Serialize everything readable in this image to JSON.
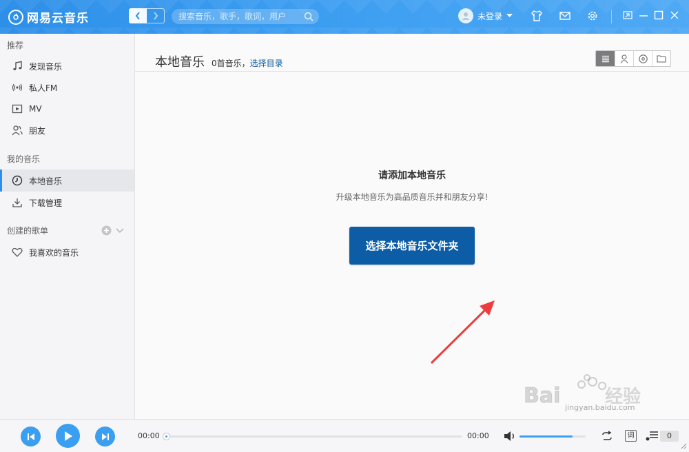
{
  "app": {
    "name": "网易云音乐"
  },
  "search": {
    "placeholder": "搜索音乐，歌手，歌词，用户"
  },
  "user": {
    "status": "未登录"
  },
  "sidebar": {
    "groups": [
      {
        "label": "推荐"
      },
      {
        "label": "我的音乐"
      },
      {
        "label": "创建的歌单"
      }
    ],
    "items": [
      {
        "label": "发现音乐",
        "icon": "music-note-icon"
      },
      {
        "label": "私人FM",
        "icon": "radio-icon"
      },
      {
        "label": "MV",
        "icon": "video-icon"
      },
      {
        "label": "朋友",
        "icon": "friends-icon"
      },
      {
        "label": "本地音乐",
        "icon": "local-music-icon",
        "active": true
      },
      {
        "label": "下载管理",
        "icon": "download-icon"
      },
      {
        "label": "我喜欢的音乐",
        "icon": "heart-icon"
      }
    ]
  },
  "main": {
    "title": "本地音乐",
    "count_text": "0首音乐，",
    "select_dir_link": "选择目录",
    "empty_title": "请添加本地音乐",
    "empty_subtitle": "升级本地音乐为高品质音乐并和朋友分享!",
    "choose_button": "选择本地音乐文件夹",
    "view_modes": [
      "list-view-icon",
      "artist-view-icon",
      "album-view-icon",
      "folder-view-icon"
    ]
  },
  "player": {
    "current_time": "00:00",
    "total_time": "00:00",
    "progress": 0,
    "volume": 0.8,
    "lyric_label": "词",
    "playlist_count": "0"
  },
  "watermark": {
    "brand": "Baidu经验",
    "url": "jingyan.baidu.com"
  },
  "colors": {
    "accent": "#2e8fe8",
    "button": "#0c5da5",
    "arrow": "#ee3b3b"
  }
}
